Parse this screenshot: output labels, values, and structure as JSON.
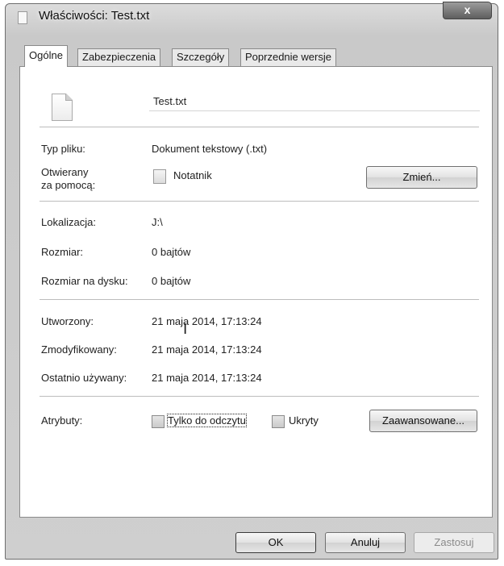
{
  "window": {
    "title": "Właściwości: Test.txt",
    "close_glyph": "x"
  },
  "tabs": [
    {
      "label": "Ogólne",
      "active": true
    },
    {
      "label": "Zabezpieczenia",
      "active": false
    },
    {
      "label": "Szczegóły",
      "active": false
    },
    {
      "label": "Poprzednie wersje",
      "active": false
    }
  ],
  "file": {
    "name": "Test.txt",
    "type_label": "Typ pliku:",
    "type_value": "Dokument tekstowy (.txt)",
    "opens_with_label_1": "Otwierany",
    "opens_with_label_2": "za pomocą:",
    "opens_with_value": "Notatnik",
    "change_button": "Zmień...",
    "location_label": "Lokalizacja:",
    "location_value": "J:\\",
    "size_label": "Rozmiar:",
    "size_value": "0 bajtów",
    "size_on_disk_label": "Rozmiar na dysku:",
    "size_on_disk_value": "0 bajtów",
    "created_label": "Utworzony:",
    "created_value": "21 maja 2014, 17:13:24",
    "modified_label": "Zmodyfikowany:",
    "modified_value": "21 maja 2014, 17:13:24",
    "accessed_label": "Ostatnio używany:",
    "accessed_value": "21 maja 2014, 17:13:24"
  },
  "attributes": {
    "label": "Atrybuty:",
    "readonly_label": "Tylko do odczytu",
    "readonly_checked": false,
    "hidden_label": "Ukryty",
    "hidden_checked": false,
    "advanced_button": "Zaawansowane..."
  },
  "footer": {
    "ok": "OK",
    "cancel": "Anuluj",
    "apply": "Zastosuj"
  }
}
